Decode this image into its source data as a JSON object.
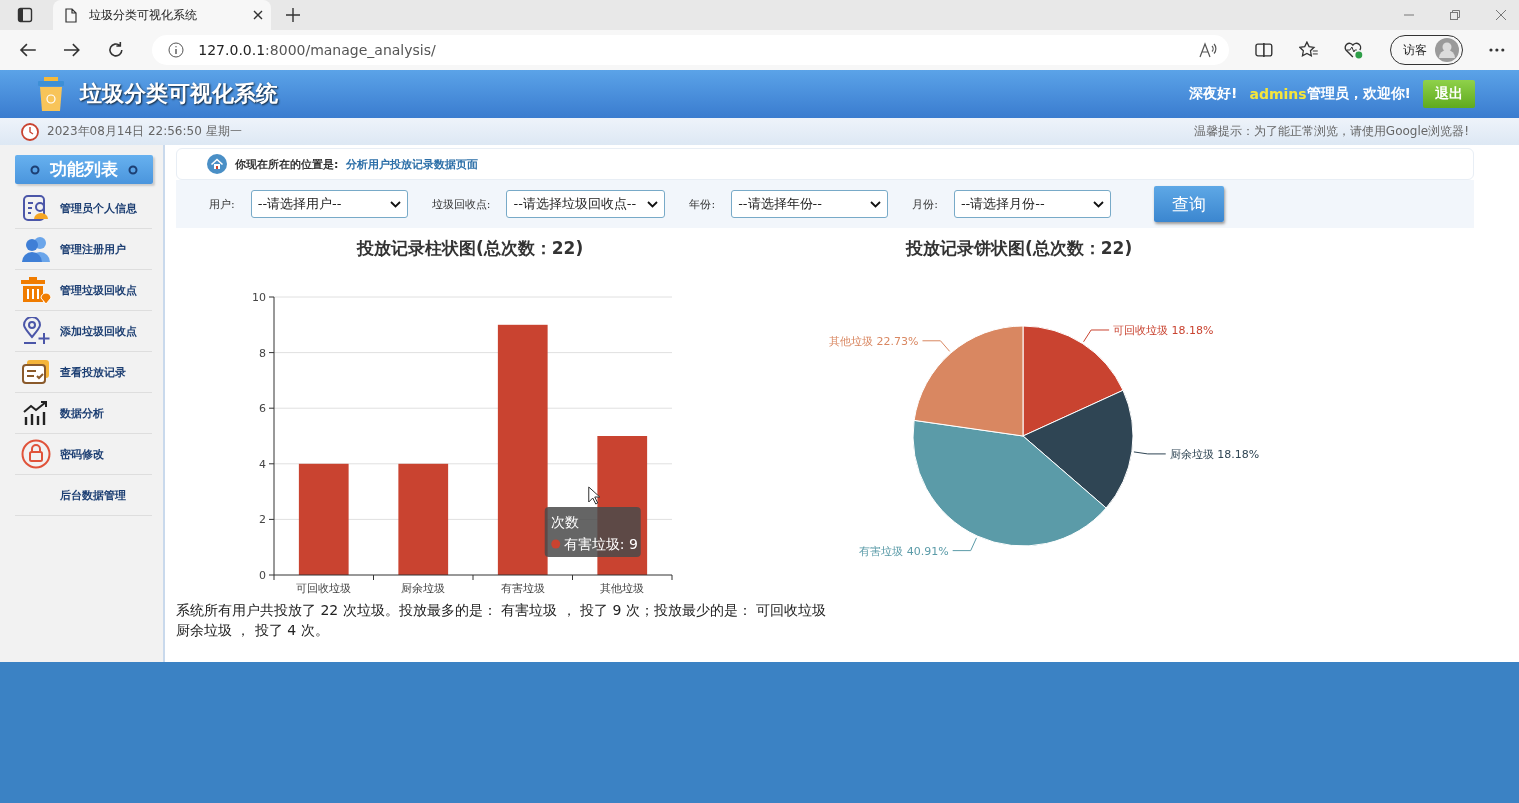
{
  "browser": {
    "tab_title": "垃圾分类可视化系统",
    "url_host": "127.0.0.1",
    "url_path": ":8000/manage_analysis/",
    "profile": "访客"
  },
  "header": {
    "title": "垃圾分类可视化系统",
    "greeting": "深夜好!",
    "username": "admins",
    "welcome": "管理员，欢迎你!",
    "logout": "退出"
  },
  "subbar": {
    "datetime": "2023年08月14日 22:56:50 星期一",
    "notice": "温馨提示：为了能正常浏览，请使用Google浏览器!"
  },
  "sidebar": {
    "heading": "功能列表",
    "items": [
      {
        "label": "管理员个人信息",
        "kind": "profile"
      },
      {
        "label": "管理注册用户",
        "kind": "users"
      },
      {
        "label": "管理垃圾回收点",
        "kind": "bin"
      },
      {
        "label": "添加垃圾回收点",
        "kind": "pin"
      },
      {
        "label": "查看投放记录",
        "kind": "records"
      },
      {
        "label": "数据分析",
        "kind": "chart"
      },
      {
        "label": "密码修改",
        "kind": "lock"
      },
      {
        "label": "后台数据管理",
        "kind": "none"
      }
    ]
  },
  "breadcrumb": {
    "prefix": "你现在所在的位置是:",
    "page": "分析用户投放记录数据页面"
  },
  "filters": [
    {
      "label": "用户:",
      "value": "--请选择用户--"
    },
    {
      "label": "垃圾回收点:",
      "value": "--请选择垃圾回收点--"
    },
    {
      "label": "年份:",
      "value": "--请选择年份--"
    },
    {
      "label": "月份:",
      "value": "--请选择月份--"
    }
  ],
  "query_button": "查询",
  "bar_chart": {
    "chart_data": {
      "type": "bar",
      "title": "投放记录柱状图(总次数：22)",
      "categories": [
        "可回收垃圾",
        "厨余垃圾",
        "有害垃圾",
        "其他垃圾"
      ],
      "series": [
        {
          "name": "次数",
          "color": "#c94330",
          "values": [
            4,
            4,
            9,
            5
          ]
        }
      ],
      "ylim": [
        0,
        10
      ],
      "yticks": [
        0,
        2,
        4,
        6,
        8,
        10
      ],
      "grid": true
    },
    "tooltip": {
      "text": "有害垃圾: 9"
    }
  },
  "pie_chart": {
    "chart_data": {
      "type": "pie",
      "title": "投放记录饼状图(总次数：22)",
      "categories": [
        "可回收垃圾",
        "厨余垃圾",
        "有害垃圾",
        "其他垃圾"
      ],
      "values": [
        18.18,
        18.18,
        40.91,
        22.73
      ],
      "colors": [
        "#c94330",
        "#2f4554",
        "#5b9ba8",
        "#d98761"
      ],
      "value_labels": [
        "18.18%",
        "18.18%",
        "40.91%",
        "22.73%"
      ]
    }
  },
  "summary": [
    "系统所有用户共投放了 22 次垃圾。投放最多的是： 有害垃圾 ， 投了 9 次；投放最少的是： 可回收垃圾",
    "厨余垃圾 ， 投了 4 次。"
  ]
}
